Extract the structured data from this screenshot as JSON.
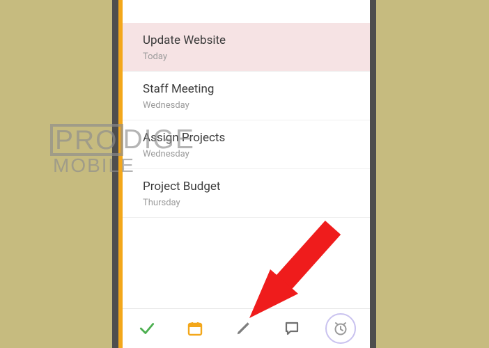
{
  "tasks": [
    {
      "title": "Update Website",
      "sub": "Today",
      "highlight": true
    },
    {
      "title": "Staff Meeting",
      "sub": "Wednesday",
      "highlight": false
    },
    {
      "title": "Assign Projects",
      "sub": "Wednesday",
      "highlight": false
    },
    {
      "title": "Project Budget",
      "sub": "Thursday",
      "highlight": false
    }
  ],
  "watermark": {
    "line1a": "PRO",
    "line1b": "DIGE",
    "line2": "MOBILE"
  },
  "toolbar_icons": [
    "check-icon",
    "calendar-icon",
    "pencil-icon",
    "comment-icon",
    "clock-icon"
  ],
  "colors": {
    "check": "#4caf50",
    "cal": "#f3a71b",
    "pencil": "#7d7d7d",
    "comment": "#6f6f6f",
    "clock": "#9a9a9a",
    "ring": "#c9c2ef",
    "arrow": "#ef1c1c"
  }
}
